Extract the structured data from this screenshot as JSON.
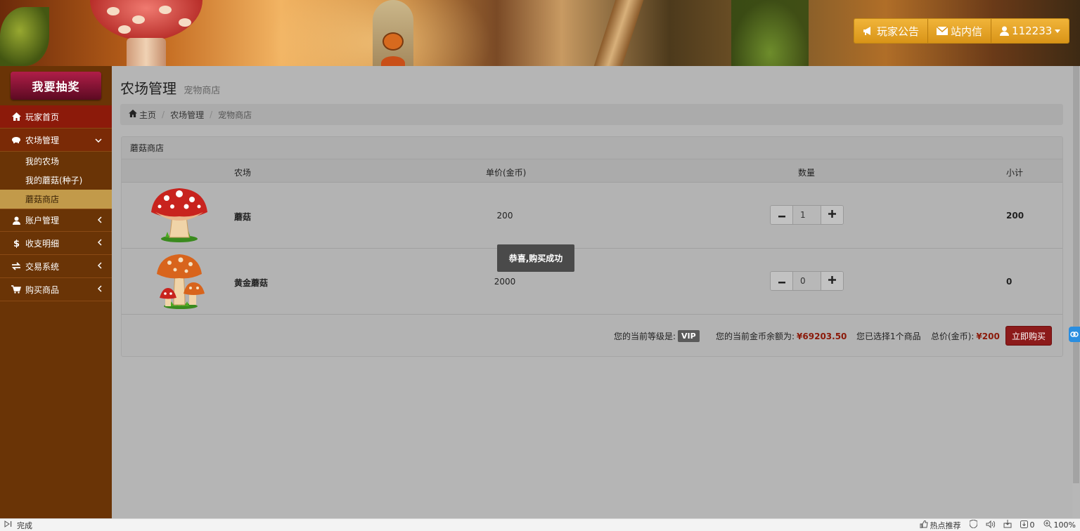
{
  "top_nav": {
    "announcement": "玩家公告",
    "messages": "站内信",
    "user": "112233"
  },
  "sidebar": {
    "lottery": "我要抽奖",
    "items": [
      {
        "label": "玩家首页",
        "icon": "home-icon"
      },
      {
        "label": "农场管理",
        "icon": "piggy-bank-icon"
      },
      {
        "label": "账户管理",
        "icon": "user-icon"
      },
      {
        "label": "收支明细",
        "icon": "dollar-icon"
      },
      {
        "label": "交易系统",
        "icon": "transfer-icon"
      },
      {
        "label": "购买商品",
        "icon": "cart-icon"
      }
    ],
    "submenu": [
      {
        "label": "我的农场"
      },
      {
        "label": "我的蘑菇(种子)"
      },
      {
        "label": "蘑菇商店",
        "active": true
      }
    ]
  },
  "page": {
    "title": "农场管理",
    "subtitle": "宠物商店"
  },
  "breadcrumb": [
    "主页",
    "农场管理",
    "宠物商店"
  ],
  "panel": {
    "heading": "蘑菇商店",
    "columns": [
      "农场",
      "单价(金币)",
      "数量",
      "小计"
    ],
    "rows": [
      {
        "name": "蘑菇",
        "price": "200",
        "qty": "1",
        "subtotal": "200",
        "image": "red-mushroom"
      },
      {
        "name": "黄金蘑菇",
        "price": "2000",
        "qty": "0",
        "subtotal": "0",
        "image": "orange-mushroom-cluster"
      }
    ],
    "footer": {
      "level_label": "您的当前等级是:",
      "level": "VIP",
      "balance_label": "您的当前金币余额为:",
      "balance": "¥69203.50",
      "selected": "您已选择1个商品",
      "total_label": "总价(金币):",
      "total": "¥200",
      "buy": "立即购买"
    }
  },
  "toast": "恭喜,购买成功",
  "statusbar": {
    "status": "完成",
    "hot": "热点推荐",
    "downloads": "0",
    "zoom": "100%"
  },
  "colors": {
    "sidebar_bg": "#6a3406",
    "home_active": "#8c1a0a",
    "submenu_active": "#c29a4a",
    "lottery_btn": "#8a1236",
    "buy_btn": "#8c1a1a",
    "top_nav": "#e6a42a",
    "price_red": "#8b1a0a"
  }
}
